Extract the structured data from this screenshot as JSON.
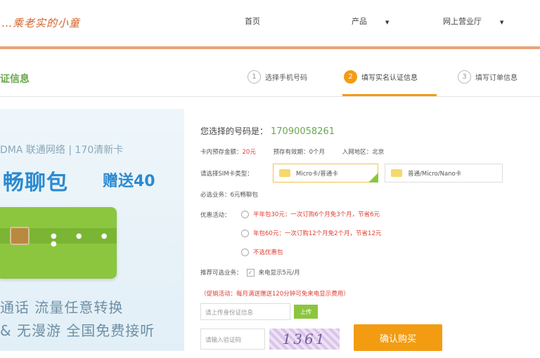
{
  "header": {
    "logo_text": "…乘老实的小童",
    "nav": [
      {
        "label": "首页",
        "has_caret": false
      },
      {
        "label": "产品",
        "has_caret": true
      },
      {
        "label": "网上营业厅",
        "has_caret": true
      }
    ],
    "caret_glyph": "▼"
  },
  "steps": {
    "section_title": "证信息",
    "items": [
      {
        "num": "1",
        "label": "选择手机号码"
      },
      {
        "num": "2",
        "label": "填写实名认证信息"
      },
      {
        "num": "3",
        "label": "填写订单信息"
      }
    ]
  },
  "promo": {
    "network_line": "DMA 联通网络 | 170清新卡",
    "product_name": "畅聊包",
    "gift_text": "赠送40",
    "line1": "通话 流量任意转换",
    "line2": "& 无漫游 全国免费接听"
  },
  "form": {
    "chosen_number_label": "您选择的号码是：",
    "chosen_number": "17090058261",
    "prepaid_label": "卡内预存金额：",
    "prepaid_value": "20元",
    "lock_label": "预存有效期：",
    "lock_value": "0个月",
    "region_label": "入网地区：",
    "region_value": "北京",
    "sim_type_label": "请选择SIM卡类型：",
    "sim_options": [
      {
        "label": "Micro卡/普通卡",
        "selected": true
      },
      {
        "label": "普通/Micro/Nano卡",
        "selected": false
      }
    ],
    "required_service_label": "必选业务：",
    "required_service_value": "6元畅聊包",
    "discount_label": "优惠活动：",
    "discount_options": [
      {
        "label": "半年包30元：一次订购6个月免3个月，节省6元"
      },
      {
        "label": "年包60元：一次订购12个月免2个月，节省12元"
      },
      {
        "label": "不选优惠包"
      }
    ],
    "recommended_label": "推荐可选业务：",
    "recommended_value": "来电显示5元/月",
    "promo_notice": "（促销活动：每月满送赠送120分钟可免来电显示费用）",
    "upload_placeholder": "请上传身份证信息",
    "upload_button": "上传",
    "captcha_placeholder": "请输入验证码",
    "captcha_text": "1361",
    "buy_button": "确认购买",
    "check_glyph": "✓"
  }
}
